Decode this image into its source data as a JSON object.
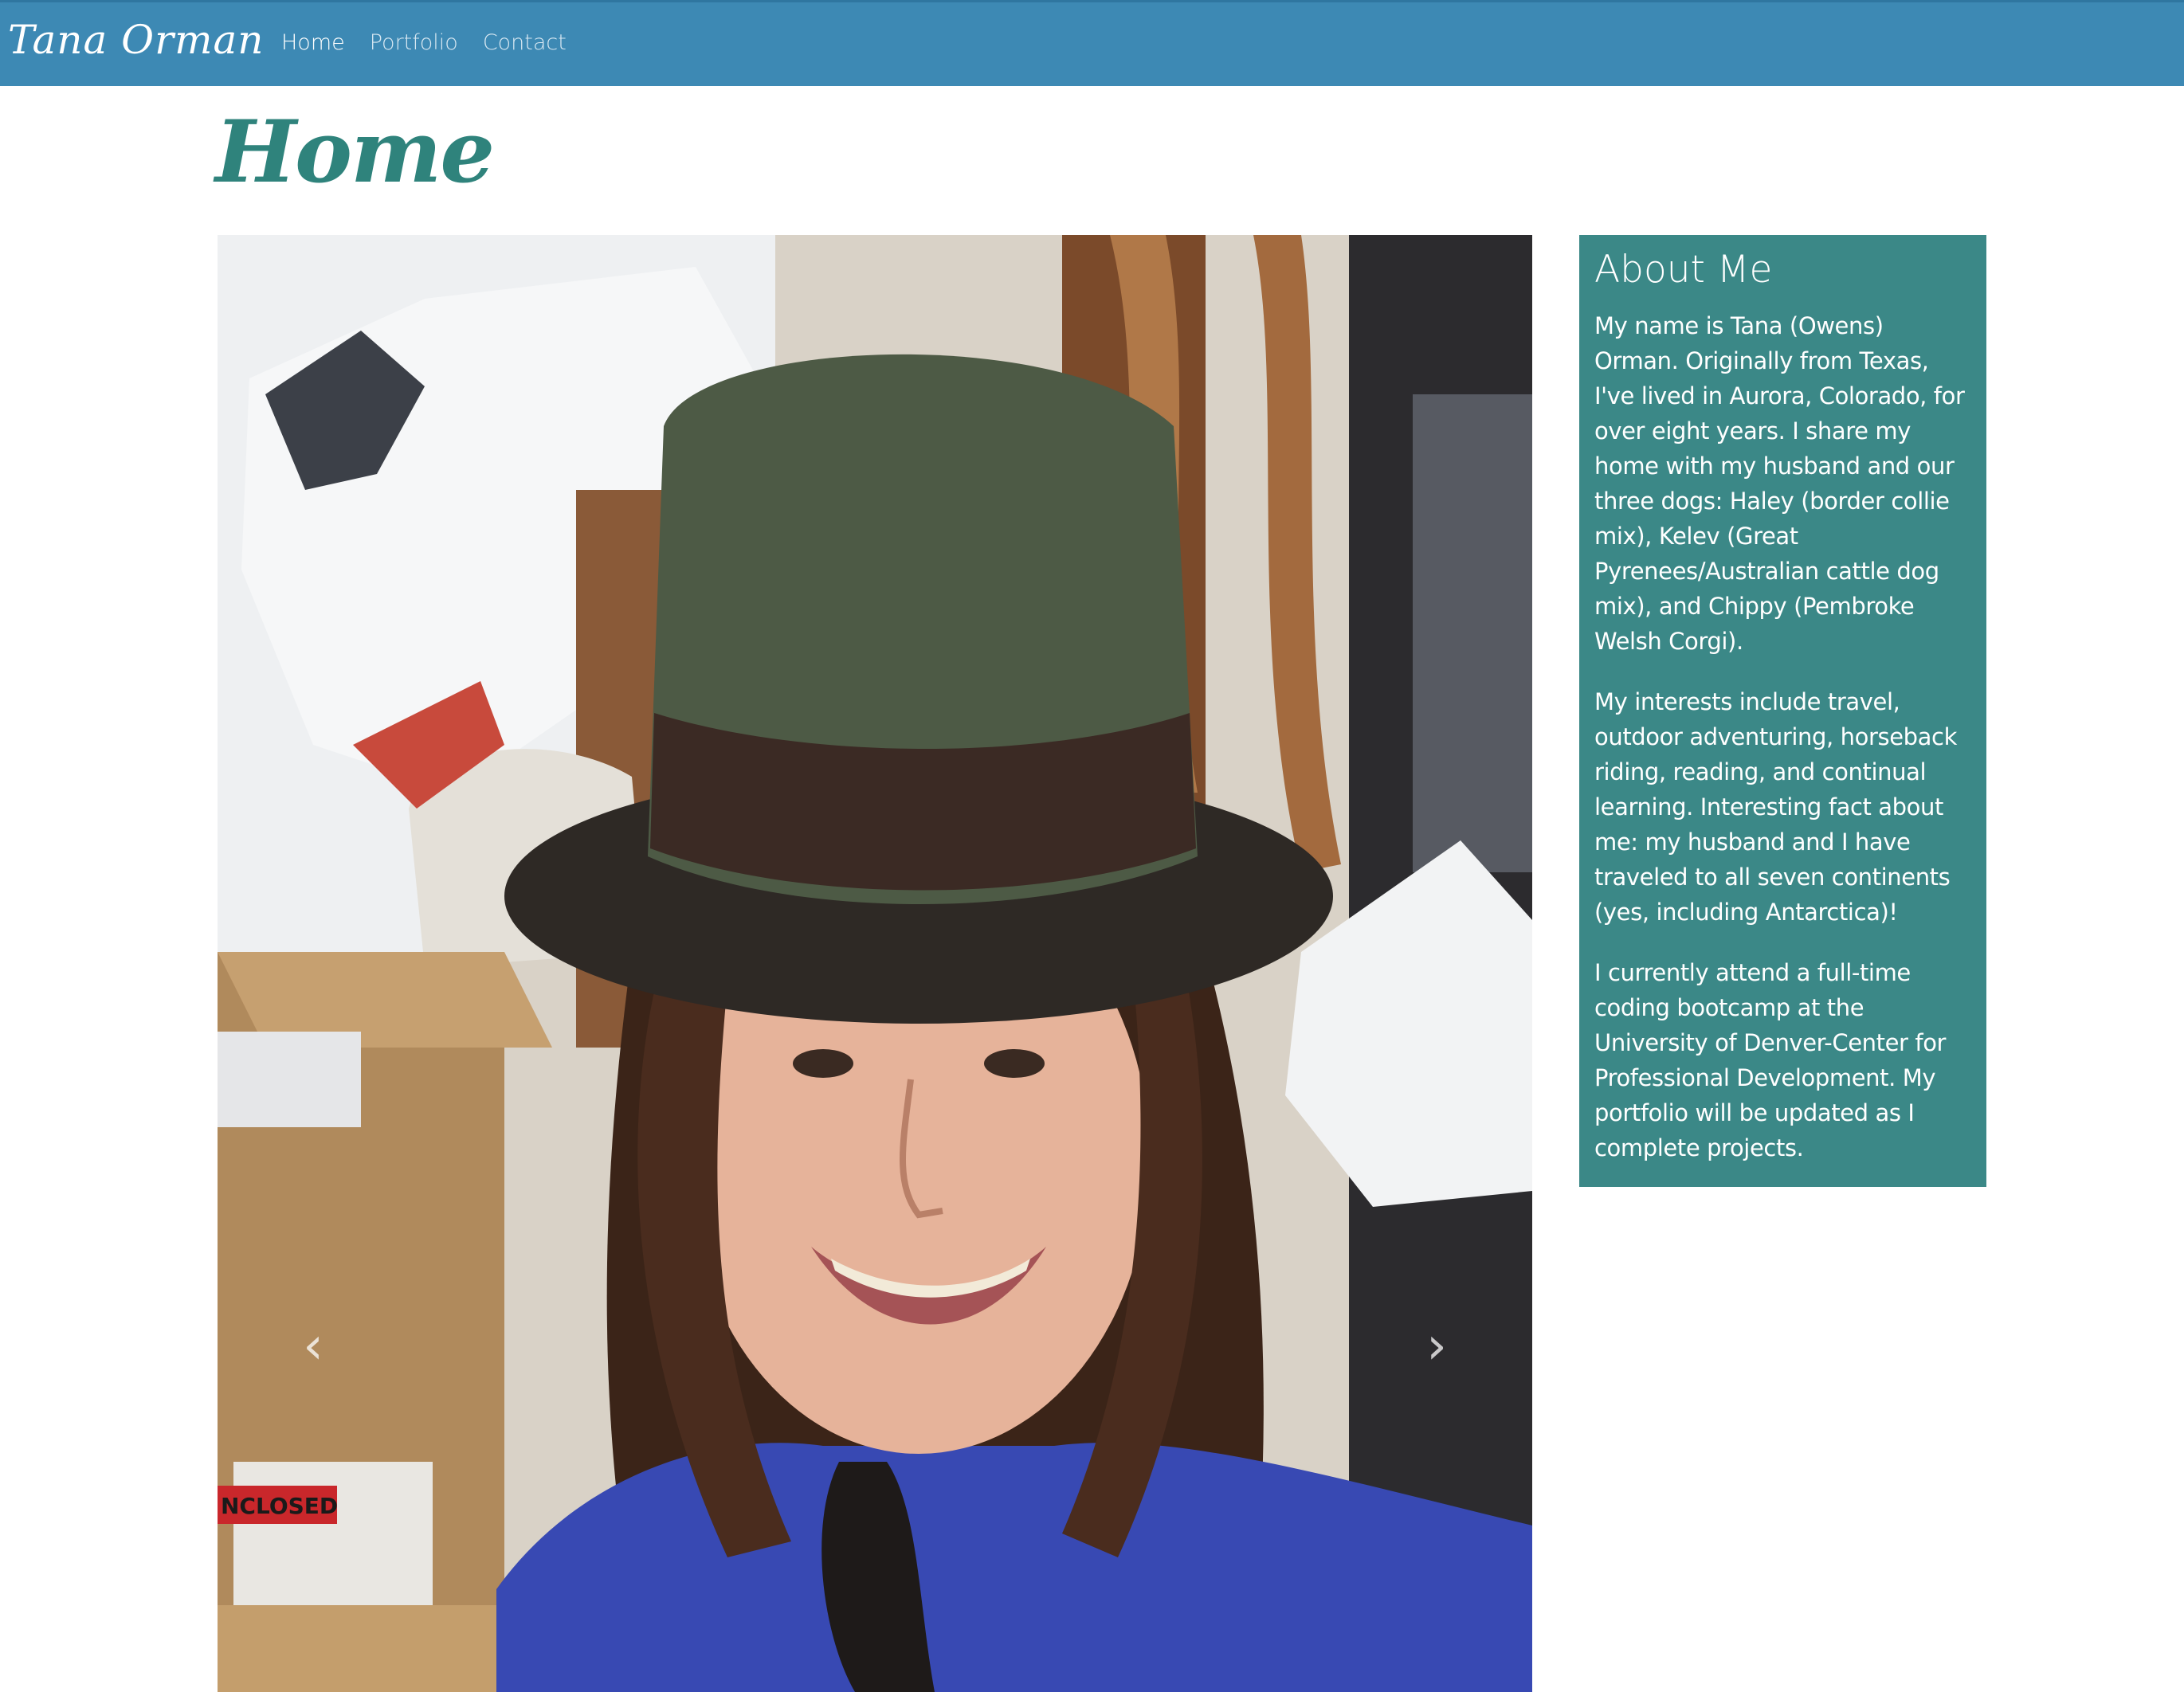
{
  "navbar": {
    "brand": "Tana Orman",
    "links": [
      {
        "label": "Home",
        "active": true
      },
      {
        "label": "Portfolio",
        "active": false
      },
      {
        "label": "Contact",
        "active": false
      }
    ],
    "background_color": "#3d89b4"
  },
  "page": {
    "title": "Home",
    "title_color": "#2f837c"
  },
  "carousel": {
    "image_label": "photo",
    "prev_icon": "chevron-left-icon",
    "next_icon": "chevron-right-icon"
  },
  "about": {
    "heading": "About Me",
    "background_color": "#3b8887",
    "paragraphs": [
      "My name is Tana (Owens) Orman. Originally from Texas, I've lived in Aurora, Colorado, for over eight years. I share my home with my husband and our three dogs: Haley (border collie mix), Kelev (Great Pyrenees/Australian cattle dog mix), and Chippy (Pembroke Welsh Corgi).",
      "My interests include travel, outdoor adventuring, horseback riding, reading, and continual learning. Interesting fact about me: my husband and I have traveled to all seven continents (yes, including Antarctica)!",
      "I currently attend a full-time coding bootcamp at the University of Denver-Center for Professional Development. My portfolio will be updated as I complete projects."
    ]
  },
  "photo_label_text": "NCLOSED"
}
